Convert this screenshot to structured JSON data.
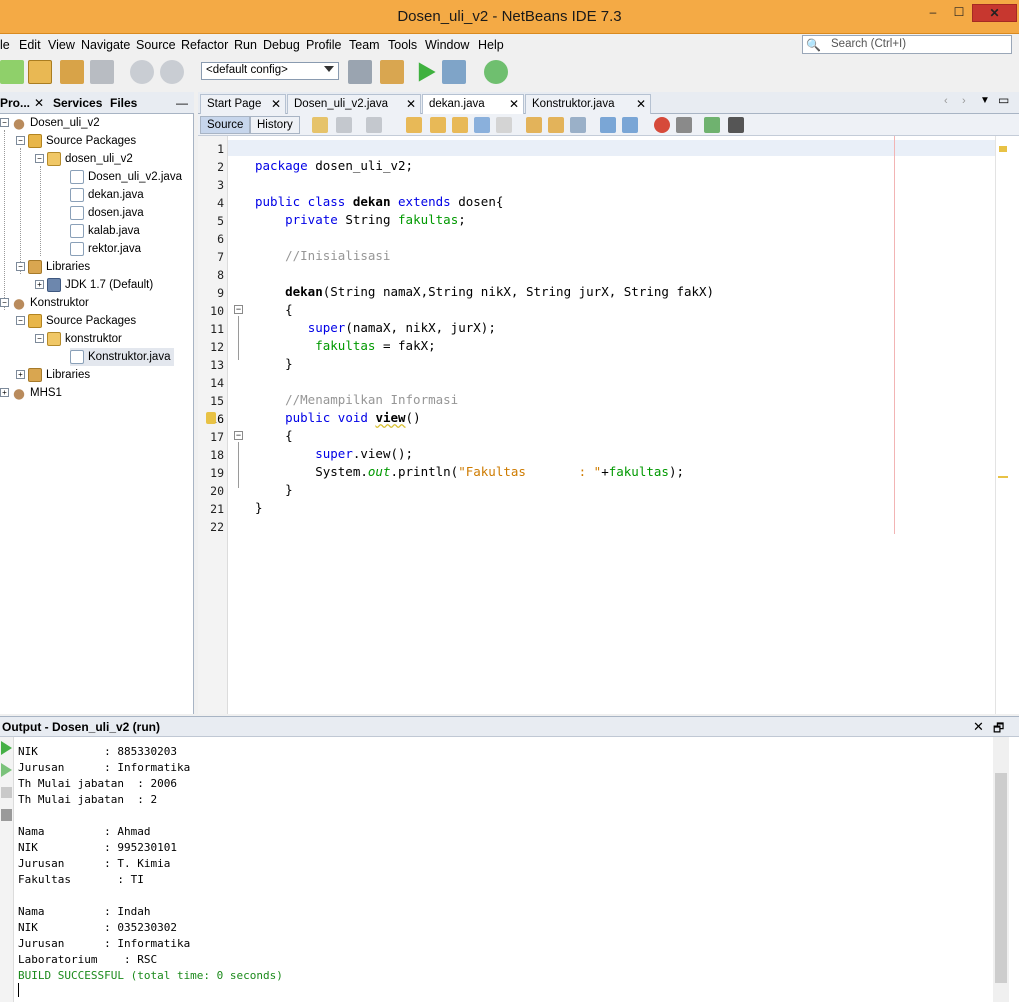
{
  "window": {
    "title": "Dosen_uli_v2 - NetBeans IDE 7.3",
    "min": "‒",
    "max": "☐",
    "close": "✕"
  },
  "menu": [
    "le",
    "Edit",
    "View",
    "Navigate",
    "Source",
    "Refactor",
    "Run",
    "Debug",
    "Profile",
    "Team",
    "Tools",
    "Window",
    "Help"
  ],
  "search": {
    "placeholder": "Search (Ctrl+I)"
  },
  "toolbar": {
    "config": "<default config>"
  },
  "projects": {
    "tabs": [
      "Pro...",
      "Services",
      "Files"
    ],
    "tree": [
      {
        "label": "Dosen_uli_v2",
        "icon": "project-icon"
      },
      {
        "label": "Source Packages",
        "icon": "source-packages-icon"
      },
      {
        "label": "dosen_uli_v2",
        "icon": "package-icon"
      },
      {
        "label": "Dosen_uli_v2.java",
        "icon": "java-file-icon"
      },
      {
        "label": "dekan.java",
        "icon": "java-file-icon"
      },
      {
        "label": "dosen.java",
        "icon": "java-file-icon"
      },
      {
        "label": "kalab.java",
        "icon": "java-file-icon"
      },
      {
        "label": "rektor.java",
        "icon": "java-file-icon"
      },
      {
        "label": "Libraries",
        "icon": "libraries-icon"
      },
      {
        "label": "JDK 1.7 (Default)",
        "icon": "jdk-icon"
      },
      {
        "label": "Konstruktor",
        "icon": "project-icon"
      },
      {
        "label": "Source Packages",
        "icon": "source-packages-icon"
      },
      {
        "label": "konstruktor",
        "icon": "package-icon"
      },
      {
        "label": "Konstruktor.java",
        "icon": "java-file-icon"
      },
      {
        "label": "Libraries",
        "icon": "libraries-icon"
      },
      {
        "label": "MHS1",
        "icon": "project-icon"
      }
    ]
  },
  "editor": {
    "tabs": [
      "Start Page",
      "Dosen_uli_v2.java",
      "dekan.java",
      "Konstruktor.java"
    ],
    "source_label": "Source",
    "history_label": "History",
    "line_numbers": [
      "1",
      "2",
      "3",
      "4",
      "5",
      "6",
      "7",
      "8",
      "9",
      "10",
      "11",
      "12",
      "13",
      "14",
      "15",
      "16",
      "17",
      "18",
      "19",
      "20",
      "21",
      "22"
    ],
    "lines": [
      "",
      "package dosen_uli_v2;",
      "",
      "public class dekan extends dosen{",
      "    private String fakultas;",
      "",
      "    //Inisialisasi",
      "",
      "    dekan(String namaX,String nikX, String jurX, String fakX)",
      "    {",
      "       super(namaX, nikX, jurX);",
      "        fakultas = fakX;",
      "    }",
      "",
      "    //Menampilkan Informasi",
      "    public void view()",
      "    {",
      "        super.view();",
      "        System.out.println(\"Fakultas       : \"+fakultas);",
      "    }",
      "}",
      ""
    ]
  },
  "output": {
    "title": "Output - Dosen_uli_v2 (run)",
    "lines": [
      "NIK          : 885330203",
      "Jurusan      : Informatika",
      "Th Mulai jabatan  : 2006",
      "Th Mulai jabatan  : 2",
      "",
      "Nama         : Ahmad",
      "NIK          : 995230101",
      "Jurusan      : T. Kimia",
      "Fakultas       : TI",
      "",
      "Nama         : Indah",
      "NIK          : 035230302",
      "Jurusan      : Informatika",
      "Laboratorium    : RSC",
      "BUILD SUCCESSFUL (total time: 0 seconds)"
    ]
  }
}
